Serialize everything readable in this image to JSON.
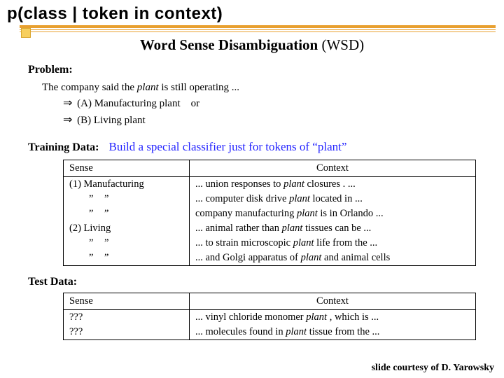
{
  "title": "p(class | token in context)",
  "heading": {
    "main": "Word Sense Disambiguation",
    "suffix": "(WSD)"
  },
  "labels": {
    "problem": "Problem:",
    "training": "Training Data:",
    "test": "Test Data:"
  },
  "problem": {
    "line_pre": "The company said the ",
    "line_it": "plant",
    "line_post": " is still operating ...",
    "choiceA": "(A) Manufacturing plant",
    "or": "or",
    "choiceB": "(B) Living plant"
  },
  "blue_note": "Build a special classifier just for tokens of “plant”",
  "train": {
    "headers": {
      "sense": "Sense",
      "context": "Context"
    },
    "rows": [
      {
        "sense": "(1) Manufacturing",
        "pre": "... union responses to ",
        "it": "plant",
        "post": "  closures . ..."
      },
      {
        "sense": "ditto",
        "pre": "... computer disk drive ",
        "it": "plant",
        "post": "  located in ..."
      },
      {
        "sense": "ditto",
        "pre": "company manufacturing ",
        "it": "plant",
        "post": "  is in Orlando ..."
      },
      {
        "sense": "(2) Living",
        "pre": "... animal rather than ",
        "it": "plant",
        "post": "  tissues can be ..."
      },
      {
        "sense": "ditto",
        "pre": "... to strain microscopic ",
        "it": "plant",
        "post": "  life from the ..."
      },
      {
        "sense": "ditto",
        "pre": "... and Golgi apparatus of ",
        "it": "plant",
        "post": "  and animal cells"
      }
    ]
  },
  "test": {
    "headers": {
      "sense": "Sense",
      "context": "Context"
    },
    "rows": [
      {
        "sense": "???",
        "pre": "... vinyl chloride monomer ",
        "it": "plant",
        "post": " , which is ..."
      },
      {
        "sense": "???",
        "pre": "... molecules found in ",
        "it": "plant",
        "post": "  tissue from the ..."
      }
    ]
  },
  "ditto": "”  ”",
  "credit": "slide courtesy of D. Yarowsky"
}
